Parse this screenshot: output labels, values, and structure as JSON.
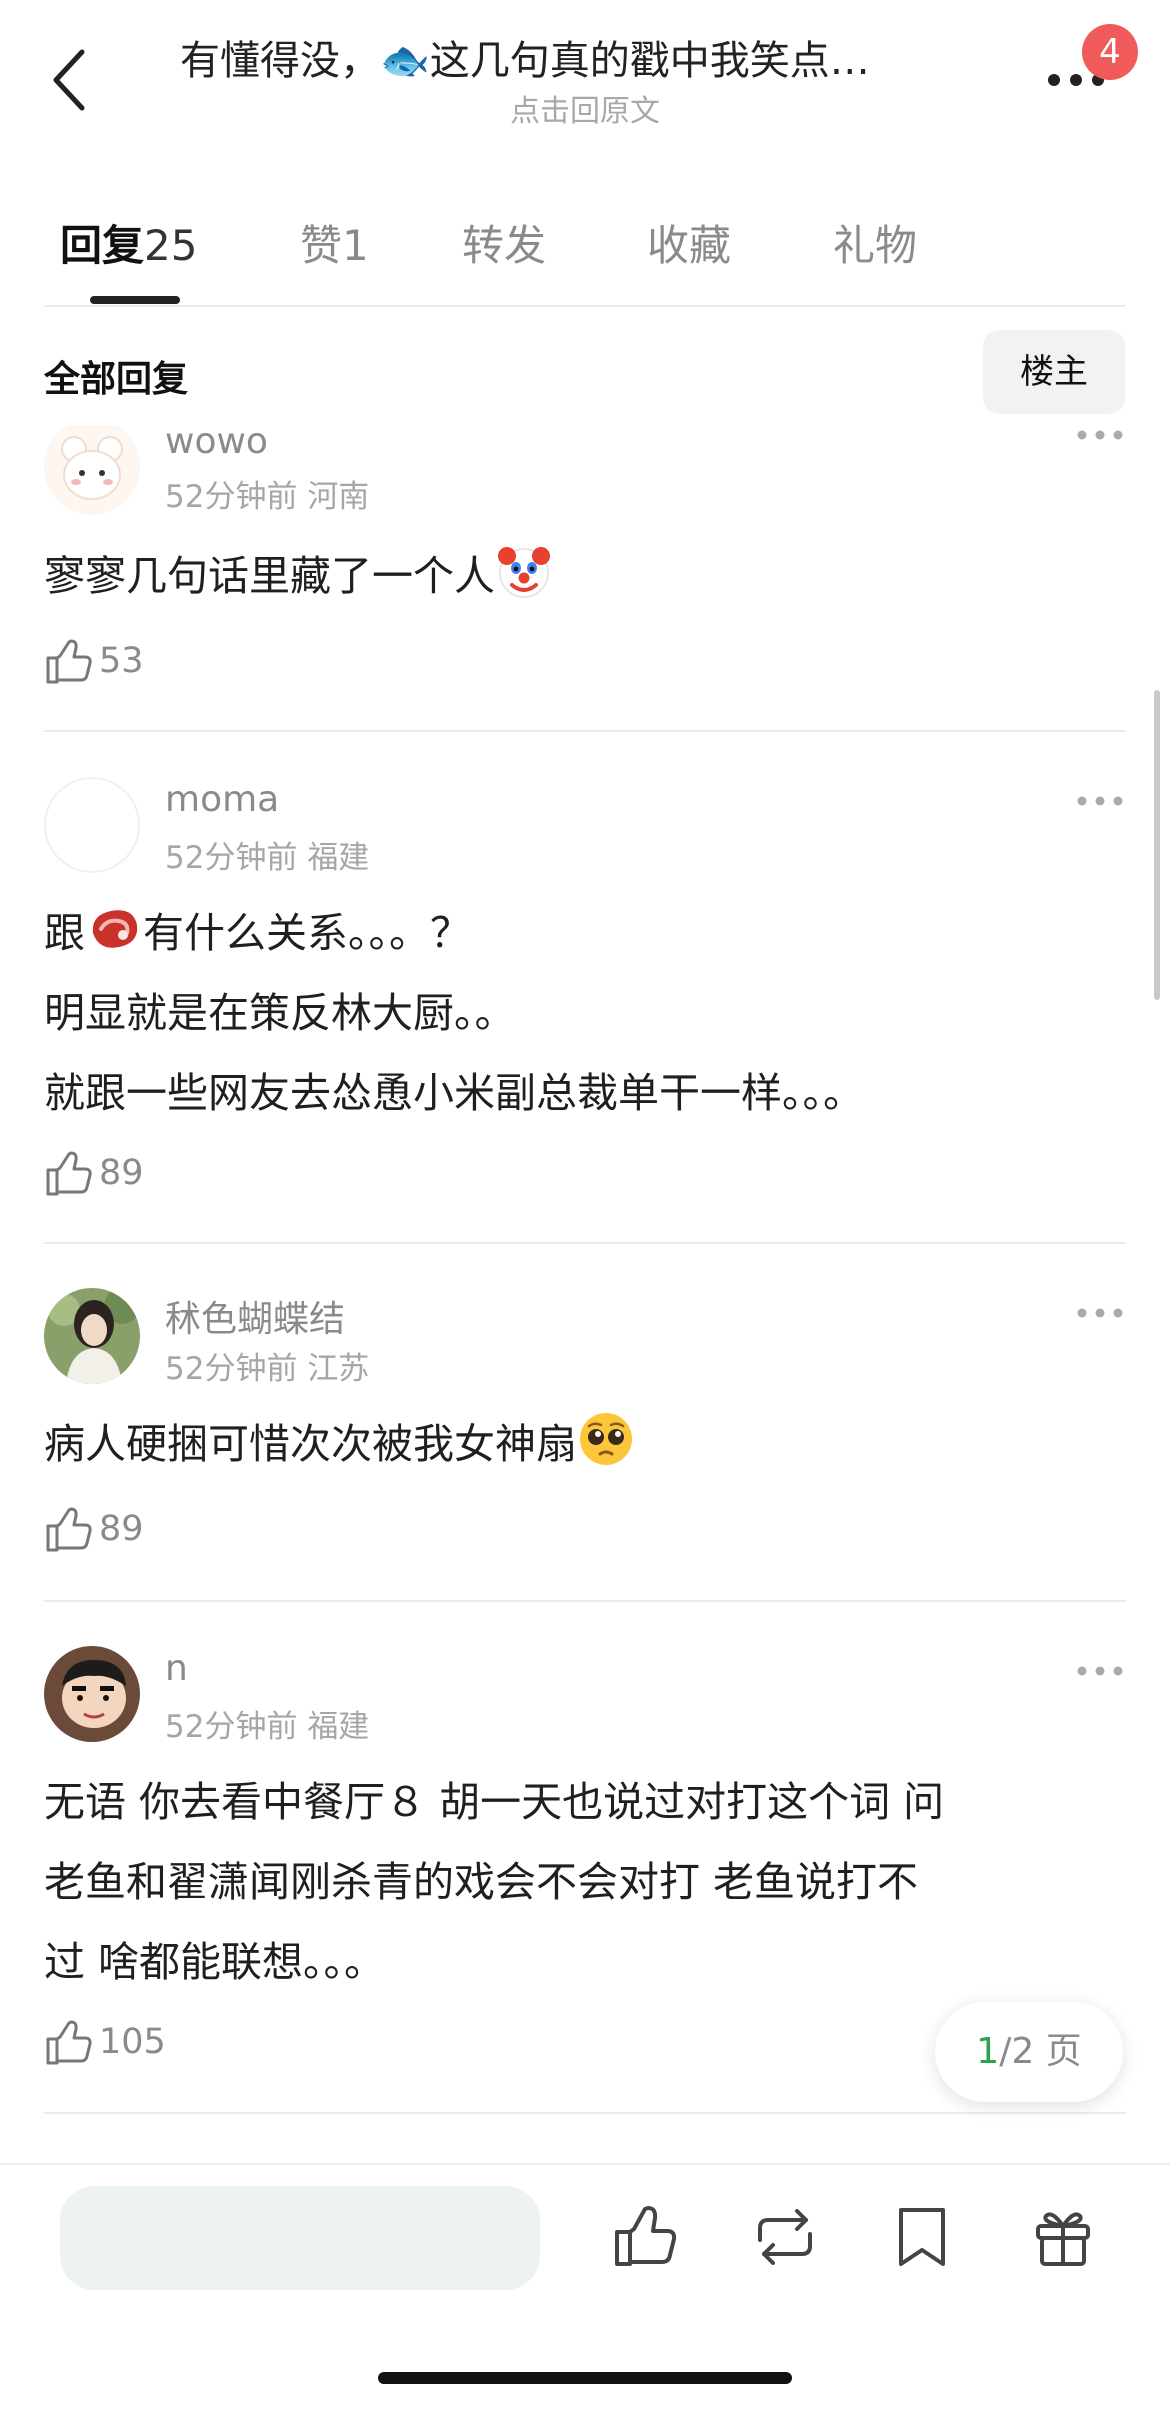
{
  "header": {
    "title": "有懂得没，🐟这几句真的戳中我笑点…",
    "subtitle": "点击回原文",
    "notification_badge": "4"
  },
  "tabs": [
    {
      "label": "回复",
      "count": "25",
      "active": true
    },
    {
      "label": "赞",
      "count": "1",
      "active": false
    },
    {
      "label": "转发",
      "count": "",
      "active": false
    },
    {
      "label": "收藏",
      "count": "",
      "active": false
    },
    {
      "label": "礼物",
      "count": "",
      "active": false
    }
  ],
  "section": {
    "title": "全部回复",
    "filter_button": "楼主"
  },
  "comments": [
    {
      "username": "wowo",
      "time": "52分钟前",
      "location": "河南",
      "text_before_emoji": "寥寥几句话里藏了一个人",
      "emoji": "clown-face",
      "likes": "53"
    },
    {
      "username": "moma",
      "time": "52分钟前",
      "location": "福建",
      "line1_prefix": "跟",
      "line1_emoji": "steak",
      "line1_suffix": "有什么关系。。。？",
      "line2": "明显就是在策反林大厨。。",
      "line3": "就跟一些网友去怂恿小米副总裁单干一样。。。",
      "likes": "89"
    },
    {
      "username": "秫色蝴蝶结",
      "time": "52分钟前",
      "location": "江苏",
      "text_before_emoji": "病人硬捆可惜次次被我女神扇",
      "emoji": "pleading-face",
      "likes": "89"
    },
    {
      "username": "n",
      "time": "52分钟前",
      "location": "福建",
      "line1": "无语 你去看中餐厅８ 胡一天也说过对打这个词 问",
      "line2": "老鱼和翟潇闻刚杀青的戏会不会对打 老鱼说打不",
      "line3": "过 啥都能联想。。。",
      "likes": "105"
    }
  ],
  "pagination": {
    "current": "1",
    "total_text": "/2 页"
  },
  "colors": {
    "accent_green": "#2aa24a",
    "badge_red": "#f05a5a",
    "input_bg": "#edf3ef"
  },
  "bottom_bar": {
    "icons": [
      "thumbs-up-icon",
      "repost-icon",
      "bookmark-icon",
      "gift-icon"
    ]
  }
}
